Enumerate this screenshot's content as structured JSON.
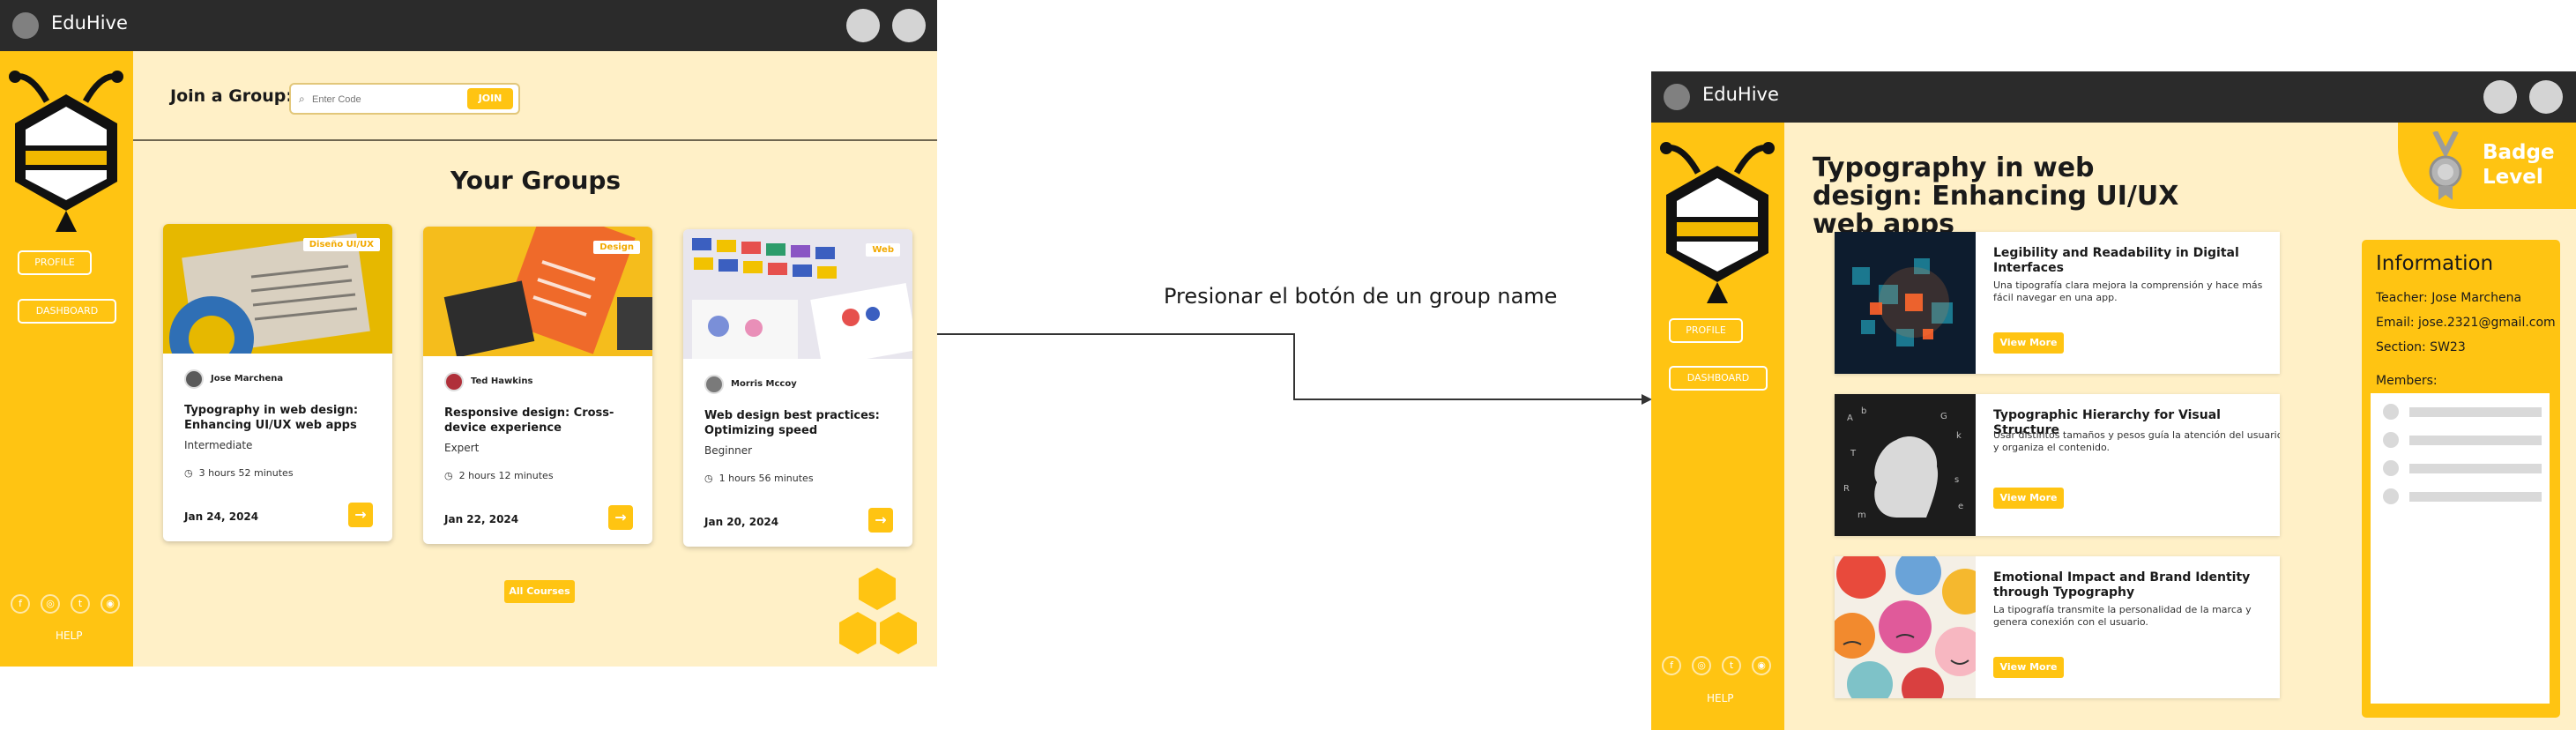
{
  "left_window": {
    "app_title": "EduHive",
    "join_label": "Join a Group:",
    "join_placeholder": "Enter Code",
    "join_button": "JOIN",
    "section_title": "Your Groups",
    "sidebar": {
      "profile": "PROFILE",
      "dashboard": "DASHBOARD",
      "help": "HELP"
    },
    "cards": [
      {
        "tag": "Diseño UI/UX",
        "author": "Jose Marchena",
        "title": "Typography in web design: Enhancing UI/UX web apps",
        "level": "Intermediate",
        "duration": "3 hours 52 minutes",
        "date": "Jan 24, 2024"
      },
      {
        "tag": "Design",
        "author": "Ted Hawkins",
        "title": "Responsive design: Cross-device experience",
        "level": "Expert",
        "duration": "2 hours 12 minutes",
        "date": "Jan 22, 2024"
      },
      {
        "tag": "Web",
        "author": "Morris Mccoy",
        "title": "Web design best practices: Optimizing speed",
        "level": "Beginner",
        "duration": "1 hours 56 minutes",
        "date": "Jan 20, 2024"
      }
    ],
    "all_courses": "All Courses"
  },
  "annotation": "Presionar el botón de un group name",
  "right_window": {
    "app_title": "EduHive",
    "title": "Typography in web design: Enhancing UI/UX web apps",
    "badge": "Badge Level",
    "sidebar": {
      "profile": "PROFILE",
      "dashboard": "DASHBOARD",
      "help": "HELP"
    },
    "articles": [
      {
        "title": "Legibility and Readability in Digital Interfaces",
        "desc": "Una tipografía clara mejora la comprensión y hace más fácil navegar en una app.",
        "button": "View More"
      },
      {
        "title": "Typographic Hierarchy for Visual Structure",
        "desc": "Usar distintos tamaños y pesos guía la atención del usuario y organiza el contenido.",
        "button": "View More"
      },
      {
        "title": "Emotional Impact and Brand Identity through Typography",
        "desc": "La tipografía transmite la personalidad de la marca y genera conexión con el usuario.",
        "button": "View More"
      }
    ],
    "info": {
      "heading": "Information",
      "teacher": "Teacher: Jose Marchena",
      "email": "Email: jose.2321@gmail.com",
      "section": "Section: SW23",
      "members_label": "Members:"
    }
  },
  "colors": {
    "brand_yellow": "#ffc412",
    "titlebar": "#2b2b2b",
    "content_bg": "#fff0c7"
  }
}
